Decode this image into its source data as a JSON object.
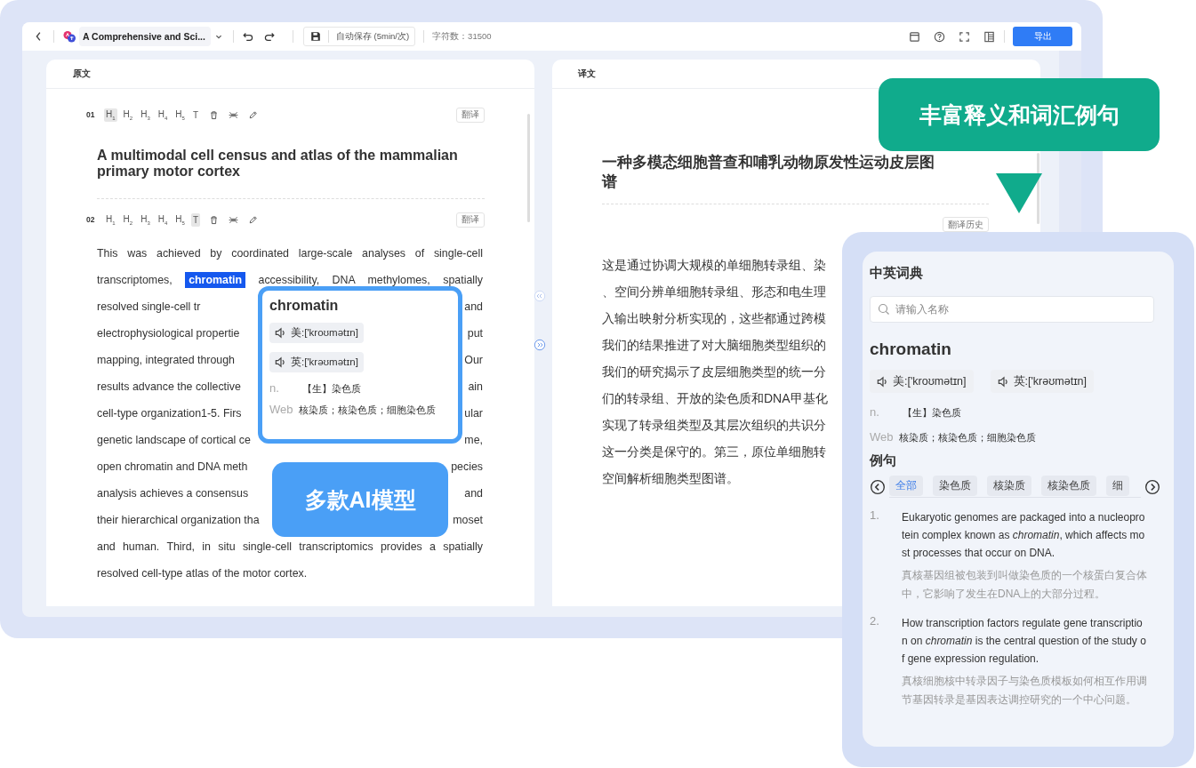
{
  "toolbar": {
    "document_title": "A Comprehensive and Sci...",
    "autosave": "自动保存 (5min/次)",
    "char_count": "字符数：31500",
    "export_button": "导出"
  },
  "source_panel": {
    "title": "原文",
    "blocks": [
      {
        "number": "01",
        "kind": "heading",
        "translate_button": "翻译",
        "tools": [
          {
            "label": "H$_{1}$",
            "selected": true
          },
          {
            "label": "H$_{2}$",
            "selected": false
          },
          {
            "label": "H$_{3}$",
            "selected": false
          },
          {
            "label": "H$_{4}$",
            "selected": false
          },
          {
            "label": "H$_{5}$",
            "selected": false
          },
          {
            "label": "T",
            "selected": false
          }
        ],
        "text": "A multimodal cell census and atlas of the mammalian primary motor cortex"
      },
      {
        "number": "02",
        "kind": "paragraph",
        "translate_button": "翻译",
        "tools": [
          {
            "label": "H$_{1}$",
            "selected": false
          },
          {
            "label": "H$_{2}$",
            "selected": false
          },
          {
            "label": "H$_{3}$",
            "selected": false
          },
          {
            "label": "H$_{4}$",
            "selected": false
          },
          {
            "label": "H$_{5}$",
            "selected": false
          },
          {
            "label": "T",
            "selected": true
          }
        ],
        "lines": [
          {
            "kind": "full",
            "parts": [
              {
                "text": "This was achieved by coordinated large-scale analyses of single-cell",
                "highlighted": false
              }
            ]
          },
          {
            "kind": "full",
            "parts": [
              {
                "text": "transcriptomes,",
                "highlighted": false
              },
              {
                "text": "chromatin",
                "highlighted": true
              },
              {
                "text": "accessibility, DNA methylomes, spatially",
                "highlighted": false
              }
            ]
          },
          {
            "kind": "split",
            "parts": [
              {
                "text": "resolved single-cell tr",
                "highlighted": false
              },
              {
                "text": "and",
                "highlighted": false
              }
            ]
          },
          {
            "kind": "split",
            "parts": [
              {
                "text": "electrophysiological propertie",
                "highlighted": false
              },
              {
                "text": "put",
                "highlighted": false
              }
            ]
          },
          {
            "kind": "split",
            "parts": [
              {
                "text": "mapping, integrated through",
                "highlighted": false
              },
              {
                "text": "Our",
                "highlighted": false
              }
            ]
          },
          {
            "kind": "split",
            "parts": [
              {
                "text": "results advance the collective",
                "highlighted": false
              },
              {
                "text": "ain",
                "highlighted": false
              }
            ]
          },
          {
            "kind": "split",
            "parts": [
              {
                "text": "cell-type organization1-5. Firs",
                "highlighted": false
              },
              {
                "text": "ular",
                "highlighted": false
              }
            ]
          },
          {
            "kind": "split",
            "parts": [
              {
                "text": "genetic landscape of cortical ce",
                "highlighted": false
              },
              {
                "text": "me,",
                "highlighted": false
              }
            ]
          },
          {
            "kind": "split",
            "parts": [
              {
                "text": "open chromatin and DNA meth",
                "highlighted": false
              },
              {
                "text": "pecies",
                "highlighted": false
              }
            ]
          },
          {
            "kind": "split",
            "parts": [
              {
                "text": "analysis achieves a consensus",
                "highlighted": false
              },
              {
                "text": "and",
                "highlighted": false
              }
            ]
          },
          {
            "kind": "split",
            "parts": [
              {
                "text": "their hierarchical organization tha",
                "highlighted": false
              },
              {
                "text": "moset",
                "highlighted": false
              }
            ]
          },
          {
            "kind": "full",
            "parts": [
              {
                "text": "and human. Third, in situ single-cell transcriptomics provides a spatially",
                "highlighted": false
              }
            ]
          },
          {
            "kind": "last",
            "parts": [
              {
                "text": "resolved cell-type atlas of the motor cortex.",
                "highlighted": false
              }
            ]
          }
        ]
      }
    ]
  },
  "translation_panel": {
    "title": "译文",
    "heading": "一种多模态细胞普查和哺乳动物原发性运动皮层图谱",
    "history_button": "翻译历史",
    "lines": [
      "这是通过协调大规模的单细胞转录组、染",
      "、空间分辨单细胞转录组、形态和电生理",
      "入输出映射分析实现的，这些都通过跨模",
      "我们的结果推进了对大脑细胞类型组织的",
      "我们的研究揭示了皮层细胞类型的统一分",
      "们的转录组、开放的染色质和DNA甲基化",
      "实现了转录组类型及其层次组织的共识分",
      "这一分类是保守的。第三，原位单细胞转",
      "空间解析细胞类型图谱。"
    ]
  },
  "word_popup": {
    "word": "chromatin",
    "pronunciations": [
      "美:['kroʊmətɪn]",
      "英:['krəʊmətɪn]"
    ],
    "definitions": [
      {
        "pos": "n.",
        "text": "【生】染色质"
      },
      {
        "pos": "Web",
        "text": "核染质；核染色质；细胞染色质"
      }
    ]
  },
  "callouts": [
    {
      "text": "多款AI模型",
      "color": "#4a9ff6"
    },
    {
      "text": "丰富释义和词汇例句",
      "color": "#10ab8c"
    }
  ],
  "dictionary": {
    "title": "中英词典",
    "search": {
      "placeholder": "请输入名称"
    },
    "word": "chromatin",
    "pronunciations": [
      "美:['kroʊmətɪn]",
      "英:['krəʊmətɪn]"
    ],
    "definitions": [
      {
        "pos": "n.",
        "text": "【生】染色质"
      },
      {
        "pos": "Web",
        "text": "核染质；核染色质；细胞染色质"
      }
    ],
    "examples_title": "例句",
    "filter_tabs": [
      {
        "label": "全部",
        "selected": true
      },
      {
        "label": "染色质",
        "selected": false
      },
      {
        "label": "核染质",
        "selected": false
      },
      {
        "label": "核染色质",
        "selected": false
      },
      {
        "label": "细",
        "selected": false
      }
    ],
    "examples": [
      {
        "number": "1.",
        "english": "Eukaryotic genomes are packaged into a nucleoprotein complex known as *chromatin*, which affects most processes that occur on DNA.",
        "chinese": "真核基因组被包装到叫做染色质的一个核蛋白复合体中，它影响了发生在DNA上的大部分过程。"
      },
      {
        "number": "2.",
        "english": "How transcription factors regulate gene transcription on *chromatin* is the central question of the study of gene expression regulation.",
        "chinese": "真核细胞核中转录因子与染色质模板如何相互作用调节基因转录是基因表达调控研究的一个中心问题。"
      }
    ]
  }
}
